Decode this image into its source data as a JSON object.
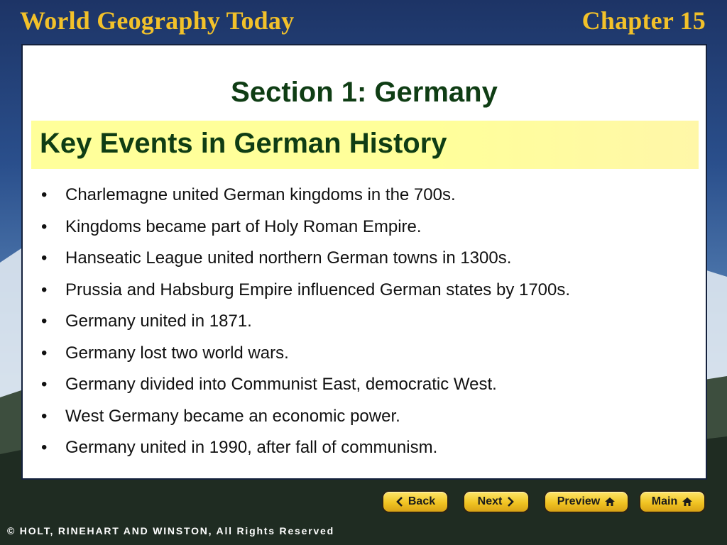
{
  "header": {
    "title": "World Geography Today",
    "chapter": "Chapter 15"
  },
  "content": {
    "section_title": "Section 1: Germany",
    "key_title": "Key Events in German History",
    "bullet_char": "•",
    "bullets": [
      "Charlemagne united German kingdoms in the 700s.",
      "Kingdoms became part of Holy Roman Empire.",
      "Hanseatic League united northern German towns in 1300s.",
      "Prussia and Habsburg Empire influenced German states by 1700s.",
      "Germany united in 1871.",
      "Germany lost two world wars.",
      "Germany divided into Communist East, democratic West.",
      "West Germany became an economic power.",
      "Germany united in 1990, after fall of communism."
    ]
  },
  "nav": {
    "back": "Back",
    "next": "Next",
    "preview": "Preview",
    "main": "Main"
  },
  "footer": {
    "copyright": "© HOLT, RINEHART AND WINSTON, All Rights Reserved"
  },
  "icons": {
    "back": "chevron-left-icon",
    "next": "chevron-right-icon",
    "preview": "home-icon",
    "main": "home-icon"
  },
  "colors": {
    "header_text": "#f2c12a",
    "title_green": "#0f3d14",
    "banner_yellow": "#ffff9a",
    "button_gold": "#f1c423"
  }
}
